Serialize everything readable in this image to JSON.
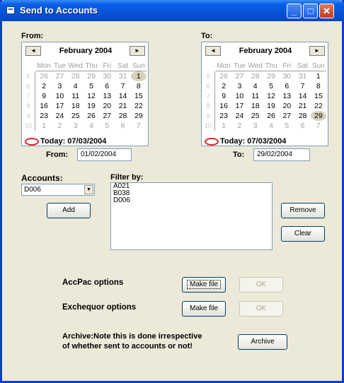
{
  "window": {
    "title": "Send to Accounts",
    "controls": {
      "minimize": "_",
      "maximize": "□",
      "close": "✕"
    }
  },
  "from": {
    "section_label": "From:",
    "calendar": {
      "month": "February 2004",
      "prev_arrow": "◄",
      "next_arrow": "►",
      "weekdays": [
        "Mon",
        "Tue",
        "Wed",
        "Thu",
        "Fri",
        "Sat",
        "Sun"
      ],
      "weeks": [
        "5",
        "6",
        "7",
        "8",
        "9",
        "10"
      ],
      "days": [
        "26",
        "27",
        "28",
        "29",
        "30",
        "31",
        "1",
        "2",
        "3",
        "4",
        "5",
        "6",
        "7",
        "8",
        "9",
        "10",
        "11",
        "12",
        "13",
        "14",
        "15",
        "16",
        "17",
        "18",
        "19",
        "20",
        "21",
        "22",
        "23",
        "24",
        "25",
        "26",
        "27",
        "28",
        "29",
        "1",
        "2",
        "3",
        "4",
        "5",
        "6",
        "7"
      ],
      "selected_day": "1",
      "today_label": "Today: 07/03/2004"
    },
    "field_label": "From:",
    "field_value": "01/02/2004"
  },
  "to": {
    "section_label": "To:",
    "calendar": {
      "month": "February 2004",
      "prev_arrow": "◄",
      "next_arrow": "►",
      "weekdays": [
        "Mon",
        "Tue",
        "Wed",
        "Thu",
        "Fri",
        "Sat",
        "Sun"
      ],
      "weeks": [
        "5",
        "6",
        "7",
        "8",
        "9",
        "10"
      ],
      "days": [
        "26",
        "27",
        "28",
        "29",
        "30",
        "31",
        "1",
        "2",
        "3",
        "4",
        "5",
        "6",
        "7",
        "8",
        "9",
        "10",
        "11",
        "12",
        "13",
        "14",
        "15",
        "16",
        "17",
        "18",
        "19",
        "20",
        "21",
        "22",
        "23",
        "24",
        "25",
        "26",
        "27",
        "28",
        "29",
        "1",
        "2",
        "3",
        "4",
        "5",
        "6",
        "7"
      ],
      "selected_day": "29",
      "today_label": "Today: 07/03/2004"
    },
    "field_label": "To:",
    "field_value": "29/02/2004"
  },
  "accounts": {
    "label": "Accounts:",
    "selected": "D006",
    "arrow": "▼",
    "add_button": "Add"
  },
  "filter": {
    "label": "Filter by:",
    "items": [
      "A021",
      "B038",
      "D006"
    ],
    "remove_button": "Remove",
    "clear_button": "Clear"
  },
  "options": {
    "accpac_label": "AccPac options",
    "accpac_make_file": "Make file",
    "accpac_ok": "OK",
    "exchequer_label": "Exchequor options",
    "exchequer_make_file": "Make file",
    "exchequer_ok": "OK",
    "archive_label_line1": "Archive:Note this is done irrespective",
    "archive_label_line2": "of whether sent to accounts or not!",
    "archive_button": "Archive"
  },
  "colors": {
    "titlebar": "#0553d6",
    "dialog_bg": "#ece9d8",
    "selected_day_bg": "#d8d2bc",
    "other_month_text": "#a0a0a0"
  }
}
